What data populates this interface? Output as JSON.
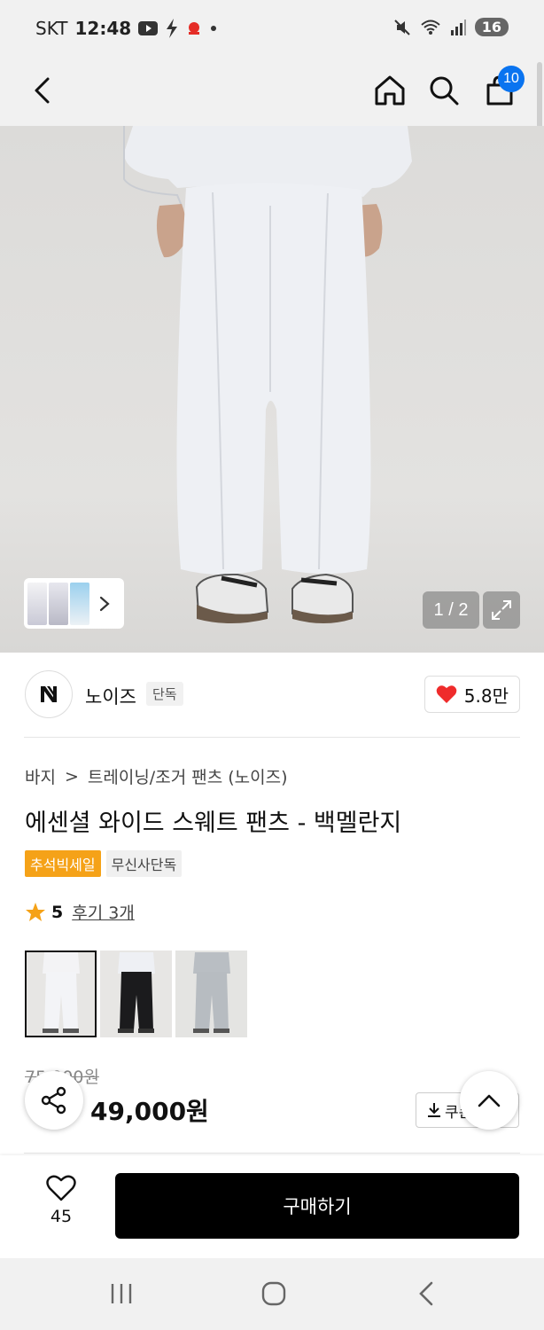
{
  "status_bar": {
    "carrier": "SKT",
    "time": "12:48",
    "battery": "16"
  },
  "nav": {
    "cart_count": "10"
  },
  "gallery": {
    "page_indicator": "1 / 2"
  },
  "brand": {
    "name": "노이즈",
    "tag": "단독",
    "likes": "5.8만"
  },
  "product": {
    "breadcrumb_category": "바지",
    "breadcrumb_sep": ">",
    "breadcrumb_sub": "트레이닝/조거 팬츠 (노이즈)",
    "title": "에센셜 와이드 스웨트 팬츠 - 백멜란지",
    "badge_sale": "추석빅세일",
    "badge_exclusive": "무신사단독",
    "rating": "5",
    "reviews": "후기 3개",
    "original_price": "75,000원",
    "price": "49,000원",
    "coupon_label": "쿠폰"
  },
  "bottom": {
    "wish_count": "45",
    "buy_label": "구매하기"
  },
  "colors": {
    "accent_blue": "#0a74f0",
    "sale_orange": "#f5a218",
    "heart_red": "#ef2b2b"
  }
}
